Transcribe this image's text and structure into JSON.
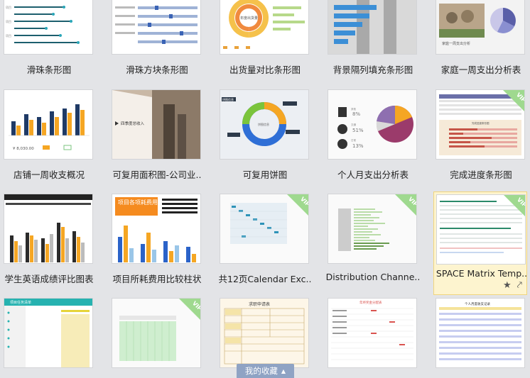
{
  "templates": [
    {
      "title": "滑珠条形图",
      "vip": false
    },
    {
      "title": "滑珠方块条形图",
      "vip": false
    },
    {
      "title": "出货量对比条形图",
      "vip": false
    },
    {
      "title": "背景隔列填充条形图",
      "vip": false
    },
    {
      "title": "家庭一周支出分析表",
      "vip": false
    },
    {
      "title": "店铺一周收支概况",
      "vip": false
    },
    {
      "title": "可复用面积图-公司业..",
      "vip": false
    },
    {
      "title": "可复用饼图",
      "vip": false
    },
    {
      "title": "个人月支出分析表",
      "vip": false
    },
    {
      "title": "完成进度条形图",
      "vip": true
    },
    {
      "title": "学生英语成绩评比图表",
      "vip": false
    },
    {
      "title": "项目所耗费用比较柱状",
      "vip": false
    },
    {
      "title": "共12页Calendar Exc..",
      "vip": true
    },
    {
      "title": "Distribution Channe..",
      "vip": true
    },
    {
      "title": "SPACE Matrix Temp..",
      "vip": true
    },
    {
      "title": "",
      "vip": false
    },
    {
      "title": "",
      "vip": true
    },
    {
      "title": "",
      "vip": false
    },
    {
      "title": "",
      "vip": false
    },
    {
      "title": "",
      "vip": false
    }
  ],
  "thumb_text": {
    "t3_center": "年度出货量",
    "t5_caption": "家庭一周支出分析",
    "t6_amount": "¥ 8,030.00",
    "t7_caption": "四季度总收入",
    "t8_tag": "饼图信息",
    "t8_center": "饼图信息",
    "t9_pct1": "8%",
    "t9_pct2": "51%",
    "t9_pct3": "13%",
    "t9_lab1": "其他",
    "t9_lab2": "交通",
    "t9_lab3": "日常",
    "t10_title": "完成进度条形图",
    "t12_title": "项目各项耗费用比较",
    "t16_title": "项目任务清单",
    "t18_title": "求职申请表",
    "t19_title": "年终奖金分配表",
    "t20_title": "个人月度收支记录"
  },
  "vip_label": "VIP",
  "selected_index": 14,
  "actions": {
    "star_icon": "★",
    "share_icon": "⤤"
  },
  "favorites_bar": {
    "label": "我的收藏",
    "icon": "▲"
  }
}
